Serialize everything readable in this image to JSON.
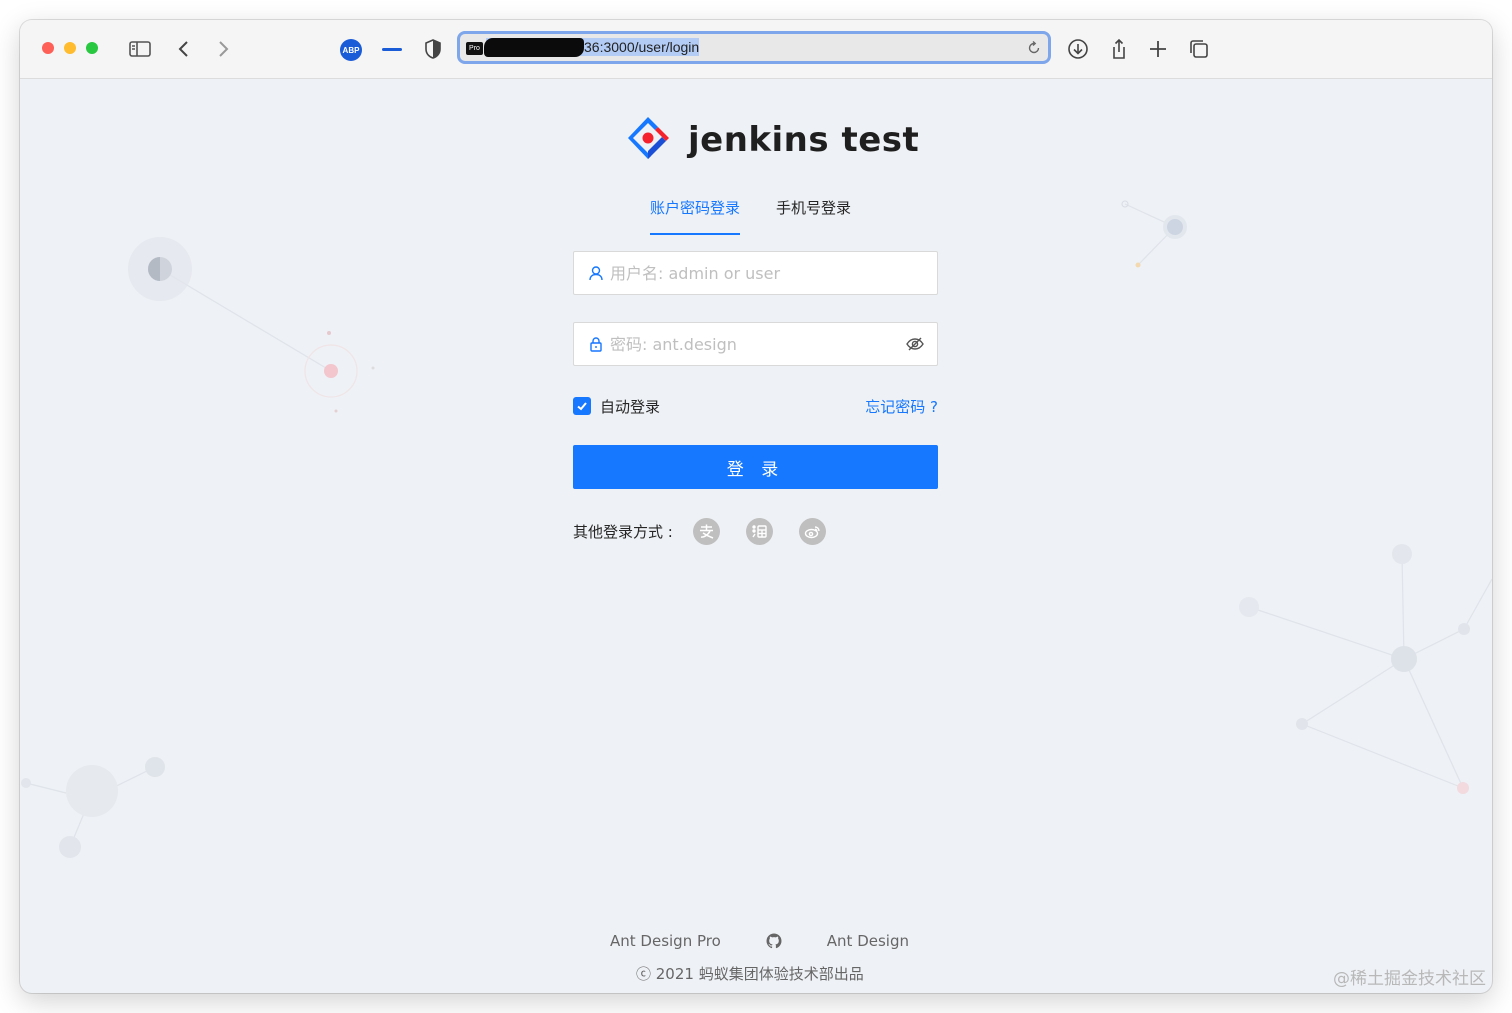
{
  "browser": {
    "url_prefix": "Pro",
    "url_visible": "36:3000/user/login"
  },
  "app": {
    "title": "jenkins test",
    "tabs": [
      {
        "label": "账户密码登录",
        "active": true
      },
      {
        "label": "手机号登录",
        "active": false
      }
    ],
    "username": {
      "placeholder": "用户名: admin or user",
      "value": ""
    },
    "password": {
      "placeholder": "密码: ant.design",
      "value": ""
    },
    "auto_login": {
      "label": "自动登录",
      "checked": true
    },
    "forgot_label": "忘记密码 ?",
    "login_label": "登 录",
    "other_login": {
      "label": "其他登录方式 :",
      "icons": [
        "alipay-icon",
        "taobao-icon",
        "weibo-icon"
      ]
    }
  },
  "footer": {
    "links": [
      "Ant Design Pro",
      "Ant Design"
    ],
    "copyright": "ⓒ 2021 蚂蚁集团体验技术部出品"
  },
  "watermark": "@稀土掘金技术社区",
  "colors": {
    "primary": "#1677ff",
    "background": "#eef1f5"
  }
}
